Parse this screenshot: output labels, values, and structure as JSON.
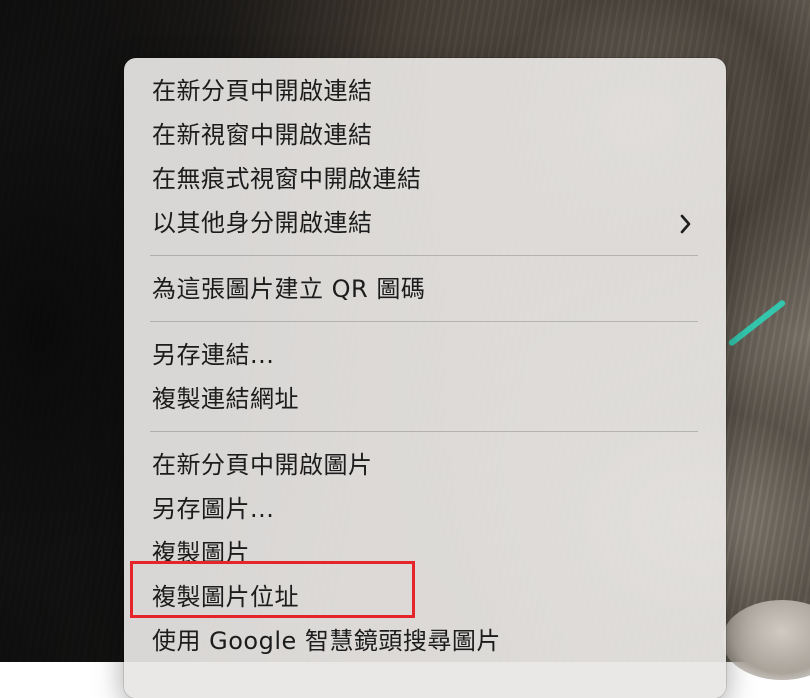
{
  "context_menu": {
    "group_link_open": [
      "在新分頁中開啟連結",
      "在新視窗中開啟連結",
      "在無痕式視窗中開啟連結",
      "以其他身分開啟連結"
    ],
    "qr": "為這張圖片建立 QR 圖碼",
    "group_link_copy": [
      "另存連結...",
      "複製連結網址"
    ],
    "group_image": [
      "在新分頁中開啟圖片",
      "另存圖片...",
      "複製圖片",
      "複製圖片位址",
      "使用 Google 智慧鏡頭搜尋圖片"
    ]
  },
  "icons": {
    "submenu_arrow": "chevron-right-icon"
  },
  "colors": {
    "highlight_border": "#e5252a",
    "menu_background": "#e8e6e4"
  }
}
